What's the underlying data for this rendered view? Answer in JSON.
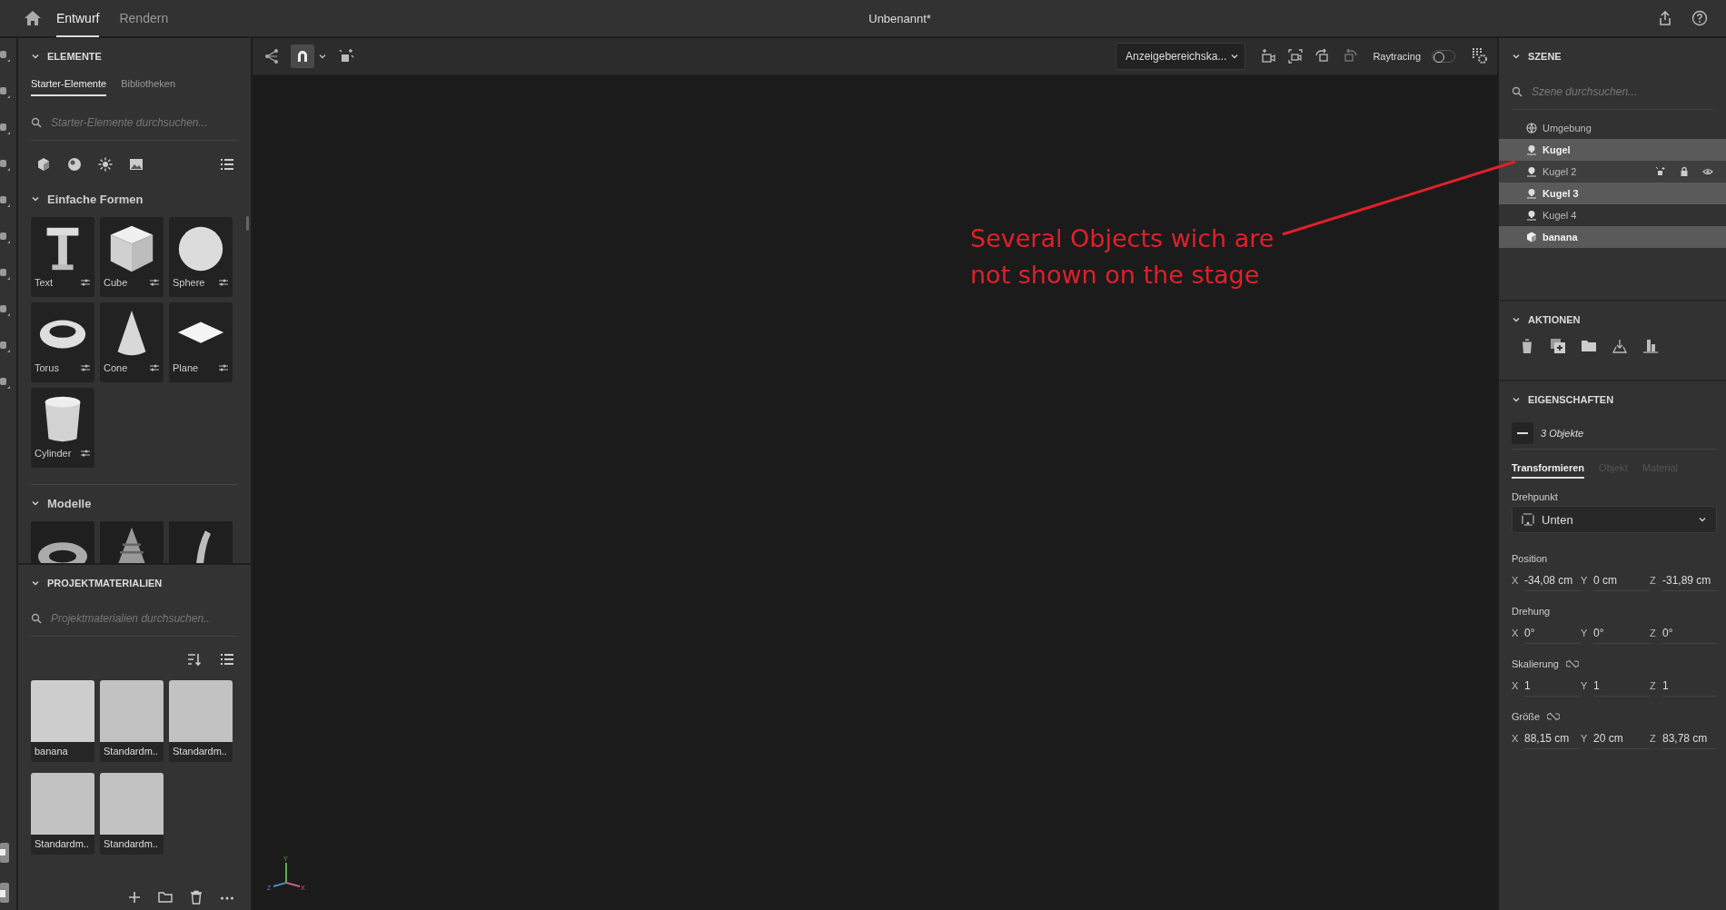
{
  "topbar": {
    "tabs": [
      {
        "label": "Entwurf",
        "selected": true
      },
      {
        "label": "Rendern",
        "selected": false
      }
    ],
    "title": "Unbenannt*"
  },
  "elements": {
    "header": "ELEMENTE",
    "tabs": [
      {
        "label": "Starter-Elemente",
        "selected": true
      },
      {
        "label": "Bibliotheken",
        "selected": false
      }
    ],
    "search": {
      "placeholder": "Starter-Elemente durchsuchen..."
    },
    "shapes_header": "Einfache Formen",
    "shapes": [
      {
        "label": "Text",
        "kind": "text"
      },
      {
        "label": "Cube",
        "kind": "cube"
      },
      {
        "label": "Sphere",
        "kind": "sphere"
      },
      {
        "label": "Torus",
        "kind": "torus"
      },
      {
        "label": "Cone",
        "kind": "cone"
      },
      {
        "label": "Plane",
        "kind": "plane"
      },
      {
        "label": "Cylinder",
        "kind": "cylinder"
      }
    ],
    "models_header": "Modelle"
  },
  "materials": {
    "header": "PROJEKTMATERIALIEN",
    "search": {
      "placeholder": "Projektmaterialien durchsuchen.."
    },
    "items": [
      {
        "label": "banana"
      },
      {
        "label": "Standardm.."
      },
      {
        "label": "Standardm.."
      },
      {
        "label": "Standardm.."
      },
      {
        "label": "Standardm.."
      }
    ]
  },
  "viewport": {
    "view_dropdown": "Anzeigebereichska...",
    "raytracing": {
      "label": "Raytracing",
      "on": false
    },
    "gizmo": {
      "y": "Y",
      "z": "Z",
      "x": "X"
    },
    "annotation": {
      "lines": [
        "Several Objects wich are",
        "not shown on the stage"
      ]
    }
  },
  "scene": {
    "header": "SZENE",
    "search": {
      "placeholder": "Szene durchsuchen..."
    },
    "items": [
      {
        "label": "Umgebung",
        "kind": "environment",
        "selected": false,
        "hovered": false
      },
      {
        "label": "Kugel",
        "kind": "light",
        "selected": true,
        "hovered": false
      },
      {
        "label": "Kugel 2",
        "kind": "light",
        "selected": false,
        "hovered": true
      },
      {
        "label": "Kugel 3",
        "kind": "light",
        "selected": true,
        "hovered": false
      },
      {
        "label": "Kugel 4",
        "kind": "light",
        "selected": false,
        "hovered": false
      },
      {
        "label": "banana",
        "kind": "model",
        "selected": true,
        "hovered": false
      }
    ]
  },
  "actions": {
    "header": "AKTIONEN"
  },
  "properties": {
    "header": "EIGENSCHAFTEN",
    "selection": "3 Objekte",
    "indeterminate": true,
    "tabs": [
      {
        "label": "Transformieren",
        "selected": true
      },
      {
        "label": "Objekt",
        "selected": false
      },
      {
        "label": "Material",
        "selected": false
      }
    ],
    "pivot": {
      "label": "Drehpunkt",
      "value": "Unten"
    },
    "groups": [
      {
        "label": "Position",
        "fields": [
          {
            "axis": "X",
            "value": "-34,08 cm"
          },
          {
            "axis": "Y",
            "value": "0 cm"
          },
          {
            "axis": "Z",
            "value": "-31,89 cm"
          }
        ]
      },
      {
        "label": "Drehung",
        "fields": [
          {
            "axis": "X",
            "value": "0°"
          },
          {
            "axis": "Y",
            "value": "0°"
          },
          {
            "axis": "Z",
            "value": "0°"
          }
        ]
      },
      {
        "label": "Skalierung",
        "linked": true,
        "fields": [
          {
            "axis": "X",
            "value": "1"
          },
          {
            "axis": "Y",
            "value": "1"
          },
          {
            "axis": "Z",
            "value": "1"
          }
        ]
      },
      {
        "label": "Größe",
        "linked": true,
        "fields": [
          {
            "axis": "X",
            "value": "88,15 cm"
          },
          {
            "axis": "Y",
            "value": "20 cm"
          },
          {
            "axis": "Z",
            "value": "83,78 cm"
          }
        ]
      }
    ]
  }
}
